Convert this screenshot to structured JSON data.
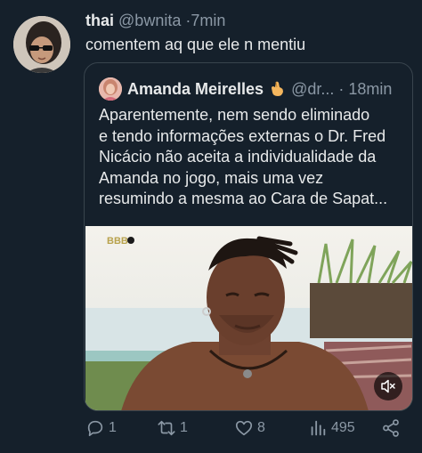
{
  "tweet": {
    "display_name": "thai",
    "handle": "@bwnita",
    "separator": "·",
    "time": "7min",
    "text": "comentem aq que ele n mentiu"
  },
  "quote": {
    "display_name": "Amanda Meirelles",
    "handle": "@dr...",
    "separator": "·",
    "time": "18min",
    "text": "Aparentemente, nem sendo eliminado\ne tendo informações externas o Dr. Fred\nNicácio não aceita a individualidade da\nAmanda no jogo, mais uma vez\nresumindo a mesma ao Cara de Sapat...",
    "media_logo": "BBB",
    "emoji": "pinched-fingers-icon"
  },
  "actions": {
    "replies": "1",
    "retweets": "1",
    "likes": "8",
    "views": "495"
  },
  "colors": {
    "background": "#15202b",
    "border": "#38444d",
    "muted": "#8b98a5",
    "text": "#e7e9ea"
  }
}
